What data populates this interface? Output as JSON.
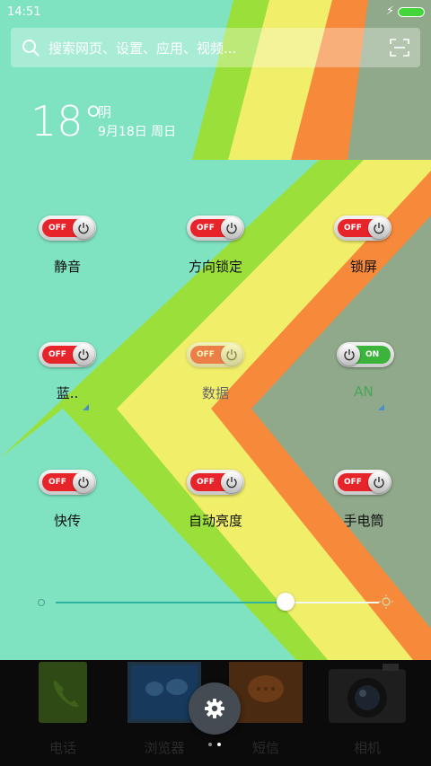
{
  "status_bar": {
    "time": "14:51"
  },
  "search": {
    "placeholder": "搜索网页、设置、应用、视频..."
  },
  "weather": {
    "temperature": "18°",
    "condition": "阴",
    "date": "9月18日 周日"
  },
  "toggles": [
    {
      "label": "静音",
      "state": "OFF"
    },
    {
      "label": "方向锁定",
      "state": "OFF"
    },
    {
      "label": "锁屏",
      "state": "OFF"
    },
    {
      "label": "蓝..",
      "state": "OFF"
    },
    {
      "label": "数据",
      "state": "OFF"
    },
    {
      "label": "AN",
      "state": "ON"
    },
    {
      "label": "快传",
      "state": "OFF"
    },
    {
      "label": "自动亮度",
      "state": "OFF"
    },
    {
      "label": "手电筒",
      "state": "OFF"
    }
  ],
  "brightness": {
    "level": 0.71
  },
  "dock": {
    "apps": [
      "电话",
      "浏览器",
      "短信",
      "相机"
    ]
  },
  "colors": {
    "mint": "#7fe3c1",
    "lime": "#9be03a",
    "yellow": "#f1ee6a",
    "orange": "#f7893a",
    "sage": "#8fa98a",
    "toggle_off": "#e8242b",
    "toggle_on": "#3cb43c"
  }
}
